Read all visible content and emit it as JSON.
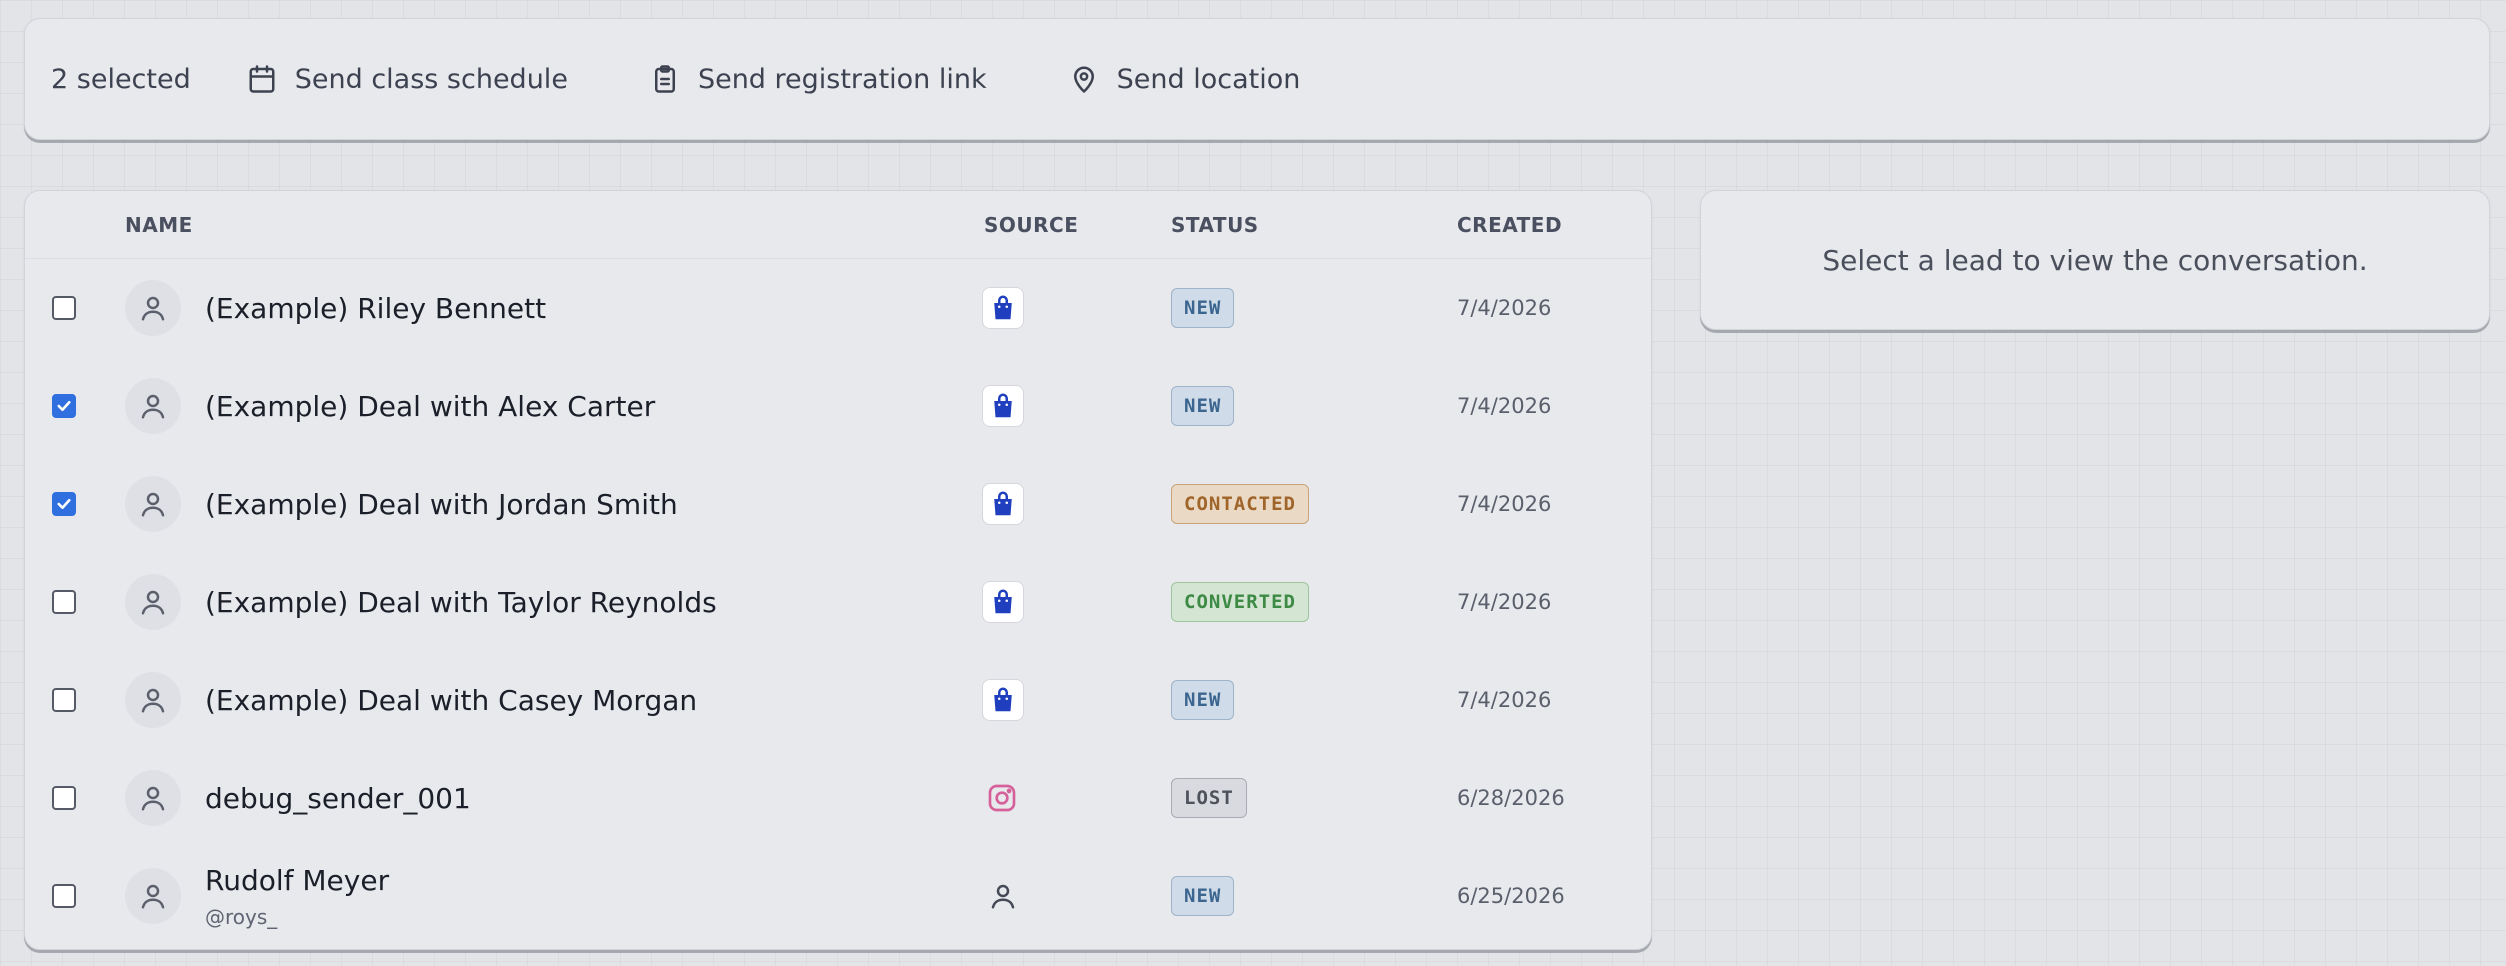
{
  "toolbar": {
    "selected_count": "2 selected",
    "actions": [
      {
        "label": "Send class schedule",
        "icon": "calendar-icon"
      },
      {
        "label": "Send registration link",
        "icon": "clipboard-icon"
      },
      {
        "label": "Send location",
        "icon": "map-pin-icon"
      }
    ]
  },
  "table": {
    "headers": {
      "name": "NAME",
      "source": "SOURCE",
      "status": "STATUS",
      "created": "CREATED"
    },
    "rows": [
      {
        "checked": false,
        "name": "(Example) Riley Bennett",
        "handle": "",
        "source": "shopping-bag-icon",
        "status": "NEW",
        "status_kind": "new",
        "created": "7/4/2026"
      },
      {
        "checked": true,
        "name": "(Example) Deal with Alex Carter",
        "handle": "",
        "source": "shopping-bag-icon",
        "status": "NEW",
        "status_kind": "new",
        "created": "7/4/2026"
      },
      {
        "checked": true,
        "name": "(Example) Deal with Jordan Smith",
        "handle": "",
        "source": "shopping-bag-icon",
        "status": "CONTACTED",
        "status_kind": "contacted",
        "created": "7/4/2026"
      },
      {
        "checked": false,
        "name": "(Example) Deal with Taylor Reynolds",
        "handle": "",
        "source": "shopping-bag-icon",
        "status": "CONVERTED",
        "status_kind": "converted",
        "created": "7/4/2026"
      },
      {
        "checked": false,
        "name": "(Example) Deal with Casey Morgan",
        "handle": "",
        "source": "shopping-bag-icon",
        "status": "NEW",
        "status_kind": "new",
        "created": "7/4/2026"
      },
      {
        "checked": false,
        "name": "debug_sender_001",
        "handle": "",
        "source": "instagram-icon",
        "status": "LOST",
        "status_kind": "lost",
        "created": "6/28/2026"
      },
      {
        "checked": false,
        "name": "Rudolf Meyer",
        "handle": "@roys_",
        "source": "user-icon",
        "status": "NEW",
        "status_kind": "new",
        "created": "6/25/2026"
      }
    ]
  },
  "side_panel": {
    "message": "Select a lead to view the conversation."
  },
  "colors": {
    "checkbox_checked": "#2f6fe0",
    "shop_icon": "#1f3fbf",
    "instagram_icon": "#d6619a"
  }
}
